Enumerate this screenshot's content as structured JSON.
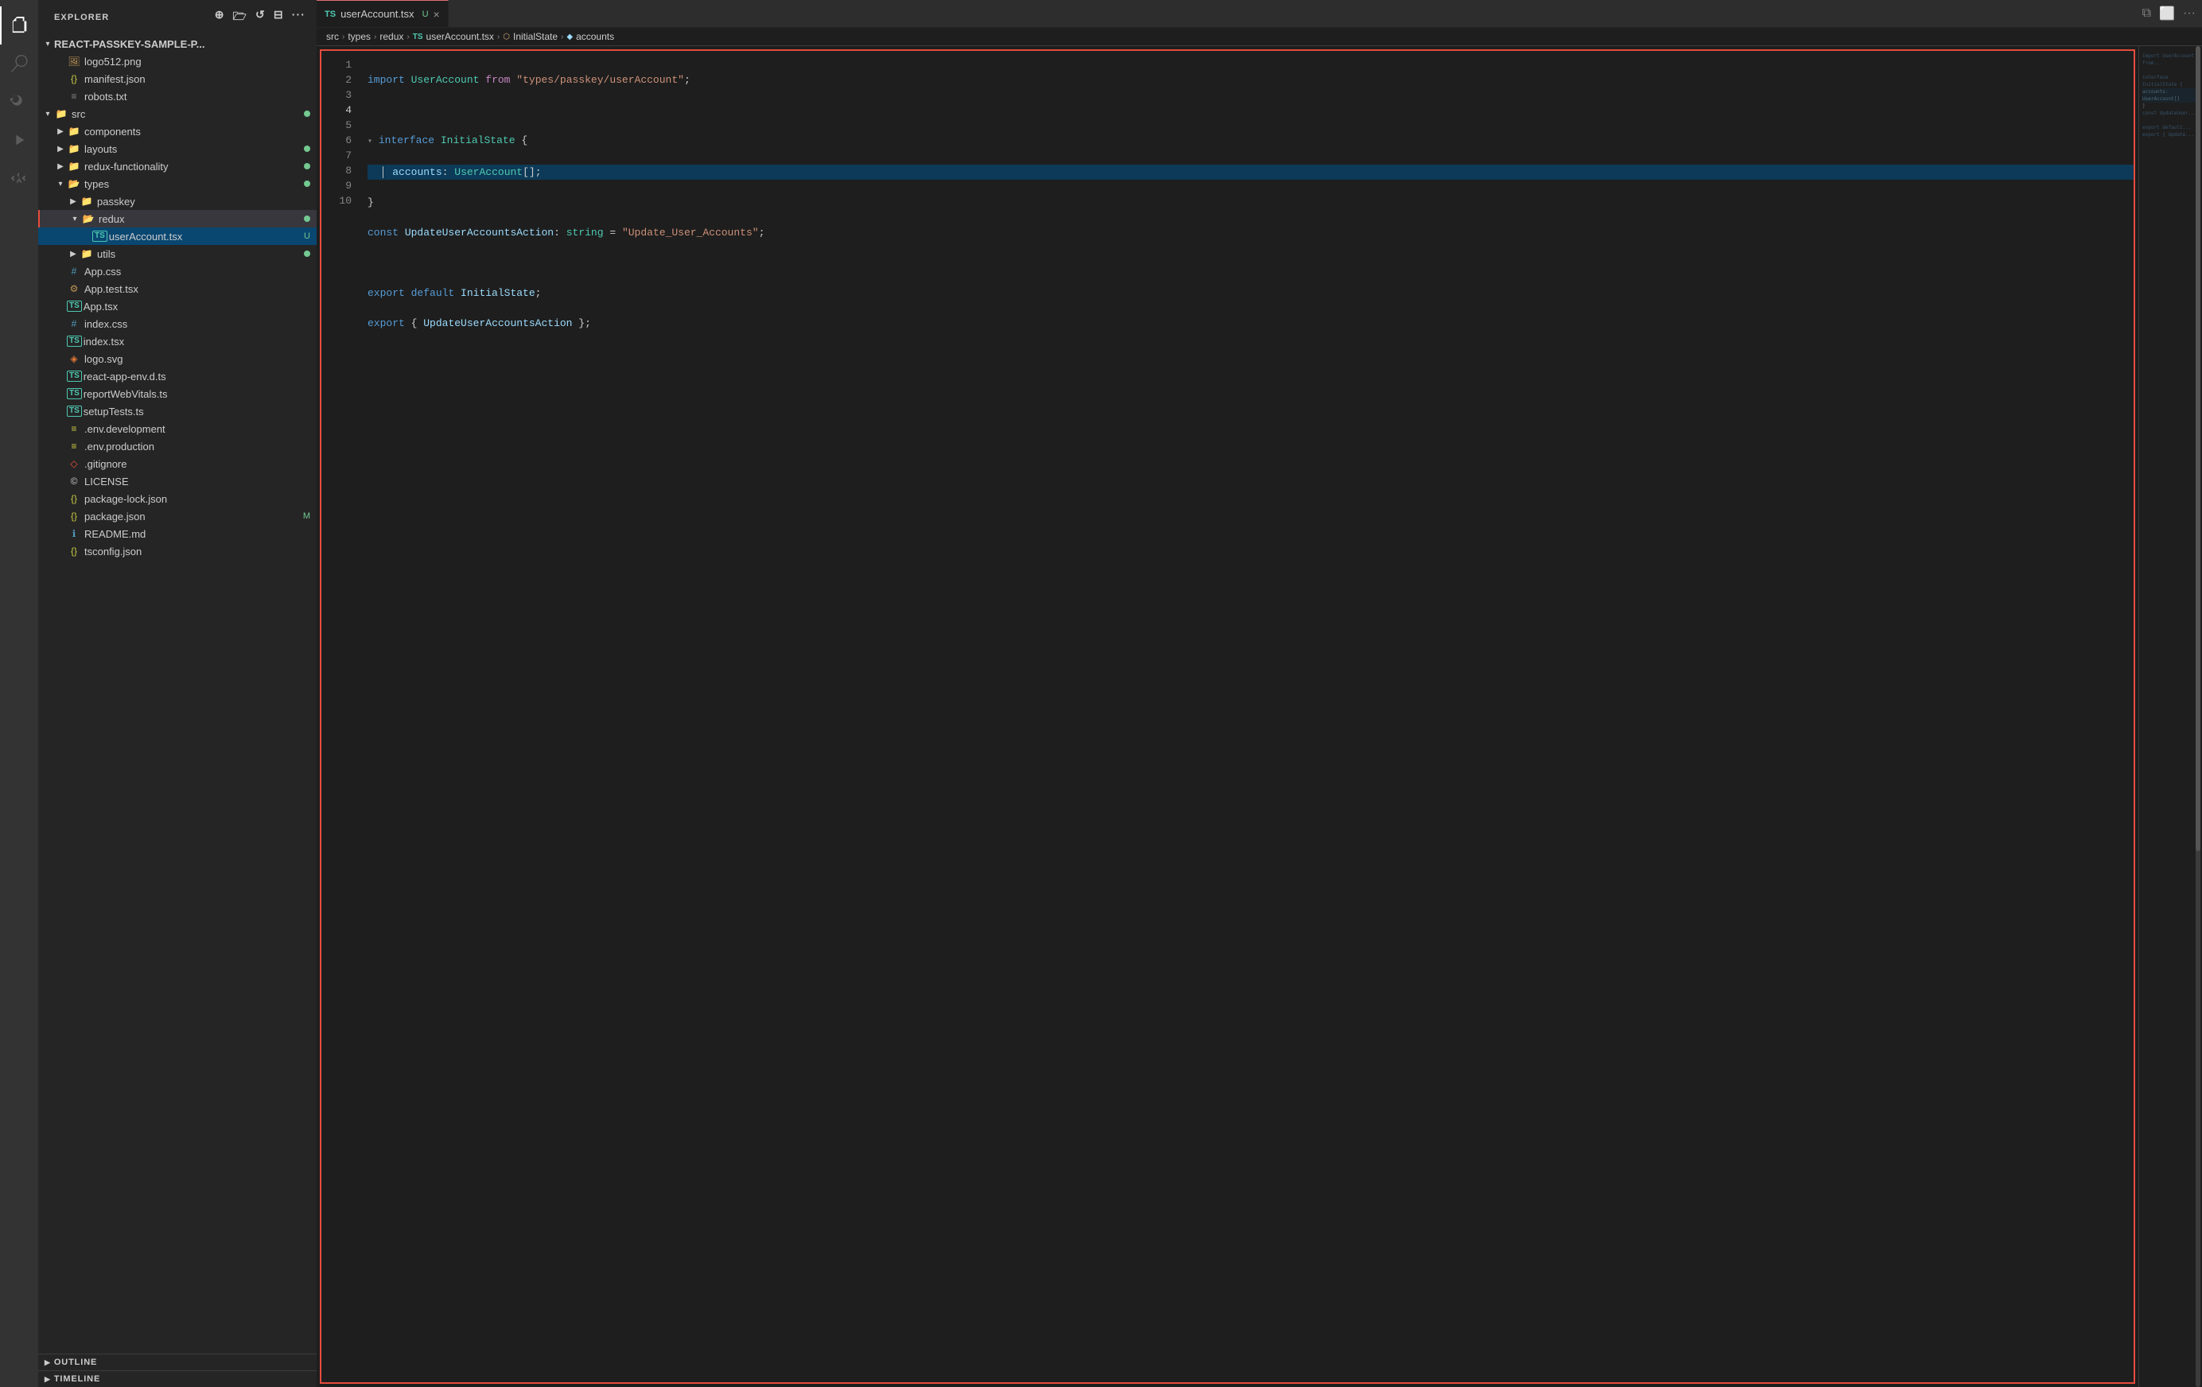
{
  "sidebar": {
    "title": "EXPLORER",
    "root_folder": "REACT-PASSKEY-SAMPLE-P...",
    "items": [
      {
        "id": "logo",
        "label": "logo512.png",
        "indent": 1,
        "type": "file",
        "icon": "image",
        "modified": ""
      },
      {
        "id": "manifest",
        "label": "manifest.json",
        "indent": 1,
        "type": "file",
        "icon": "json",
        "modified": ""
      },
      {
        "id": "robots",
        "label": "robots.txt",
        "indent": 1,
        "type": "file",
        "icon": "txt",
        "modified": ""
      },
      {
        "id": "src",
        "label": "src",
        "indent": 0,
        "type": "folder",
        "expanded": true,
        "dot": true
      },
      {
        "id": "components",
        "label": "components",
        "indent": 1,
        "type": "folder",
        "expanded": false
      },
      {
        "id": "layouts",
        "label": "layouts",
        "indent": 1,
        "type": "folder",
        "expanded": false,
        "dot": true
      },
      {
        "id": "redux-functionality",
        "label": "redux-functionality",
        "indent": 1,
        "type": "folder",
        "expanded": false,
        "dot": true
      },
      {
        "id": "types",
        "label": "types",
        "indent": 1,
        "type": "folder",
        "expanded": true,
        "dot": true
      },
      {
        "id": "passkey",
        "label": "passkey",
        "indent": 2,
        "type": "folder",
        "expanded": false
      },
      {
        "id": "redux",
        "label": "redux",
        "indent": 2,
        "type": "folder",
        "expanded": true,
        "active": true,
        "dot": true
      },
      {
        "id": "userAccount",
        "label": "userAccount.tsx",
        "indent": 3,
        "type": "ts-file",
        "modified": "U",
        "selected": true
      },
      {
        "id": "utils",
        "label": "utils",
        "indent": 2,
        "type": "folder",
        "expanded": false,
        "dot": true
      },
      {
        "id": "AppCss",
        "label": "App.css",
        "indent": 1,
        "type": "file",
        "icon": "css"
      },
      {
        "id": "AppTest",
        "label": "App.test.tsx",
        "indent": 1,
        "type": "file",
        "icon": "test"
      },
      {
        "id": "AppTsx",
        "label": "App.tsx",
        "indent": 1,
        "type": "ts-file"
      },
      {
        "id": "indexCss",
        "label": "index.css",
        "indent": 1,
        "type": "file",
        "icon": "css"
      },
      {
        "id": "indexTsx",
        "label": "index.tsx",
        "indent": 1,
        "type": "ts-file"
      },
      {
        "id": "logoSvg",
        "label": "logo.svg",
        "indent": 1,
        "type": "file",
        "icon": "svg"
      },
      {
        "id": "reactAppEnv",
        "label": "react-app-env.d.ts",
        "indent": 1,
        "type": "ts-file"
      },
      {
        "id": "reportWebVitals",
        "label": "reportWebVitals.ts",
        "indent": 1,
        "type": "ts-file"
      },
      {
        "id": "setupTests",
        "label": "setupTests.ts",
        "indent": 1,
        "type": "ts-file"
      },
      {
        "id": "envDev",
        "label": ".env.development",
        "indent": 1,
        "type": "file",
        "icon": "env"
      },
      {
        "id": "envProd",
        "label": ".env.production",
        "indent": 1,
        "type": "file",
        "icon": "env"
      },
      {
        "id": "gitignore",
        "label": ".gitignore",
        "indent": 1,
        "type": "file",
        "icon": "git"
      },
      {
        "id": "license",
        "label": "LICENSE",
        "indent": 1,
        "type": "file",
        "icon": "license"
      },
      {
        "id": "packageLock",
        "label": "package-lock.json",
        "indent": 1,
        "type": "file",
        "icon": "json"
      },
      {
        "id": "package",
        "label": "package.json",
        "indent": 1,
        "type": "file",
        "icon": "json",
        "modified": "M"
      },
      {
        "id": "readme",
        "label": "README.md",
        "indent": 1,
        "type": "file",
        "icon": "md"
      },
      {
        "id": "tsconfig",
        "label": "tsconfig.json",
        "indent": 1,
        "type": "file",
        "icon": "json"
      }
    ]
  },
  "bottom_sections": [
    {
      "id": "outline",
      "label": "OUTLINE",
      "expanded": false
    },
    {
      "id": "timeline",
      "label": "TIMELINE",
      "expanded": false
    }
  ],
  "editor": {
    "tab": {
      "ts_prefix": "TS",
      "filename": "userAccount.tsx",
      "modified_badge": "U",
      "close_icon": "×"
    },
    "breadcrumb": [
      {
        "label": "src",
        "type": "text"
      },
      {
        "label": ">",
        "type": "sep"
      },
      {
        "label": "types",
        "type": "text"
      },
      {
        "label": ">",
        "type": "sep"
      },
      {
        "label": "redux",
        "type": "text"
      },
      {
        "label": ">",
        "type": "sep"
      },
      {
        "label": "TS",
        "type": "ts-icon"
      },
      {
        "label": "userAccount.tsx",
        "type": "text"
      },
      {
        "label": ">",
        "type": "sep"
      },
      {
        "label": "⬡",
        "type": "interface-icon"
      },
      {
        "label": "InitialState",
        "type": "text"
      },
      {
        "label": ">",
        "type": "sep"
      },
      {
        "label": "◆",
        "type": "property-icon"
      },
      {
        "label": "accounts",
        "type": "text"
      }
    ],
    "lines": [
      {
        "num": 1,
        "code": "import_line"
      },
      {
        "num": 2,
        "code": "empty"
      },
      {
        "num": 3,
        "code": "interface_decl"
      },
      {
        "num": 4,
        "code": "accounts_prop",
        "active": true
      },
      {
        "num": 5,
        "code": "close_brace"
      },
      {
        "num": 6,
        "code": "const_line"
      },
      {
        "num": 7,
        "code": "empty"
      },
      {
        "num": 8,
        "code": "export_default"
      },
      {
        "num": 9,
        "code": "export_named"
      },
      {
        "num": 10,
        "code": "empty"
      }
    ]
  },
  "top_right_icons": {
    "split_editor": "⧉",
    "layout": "⬜",
    "more": "···"
  }
}
